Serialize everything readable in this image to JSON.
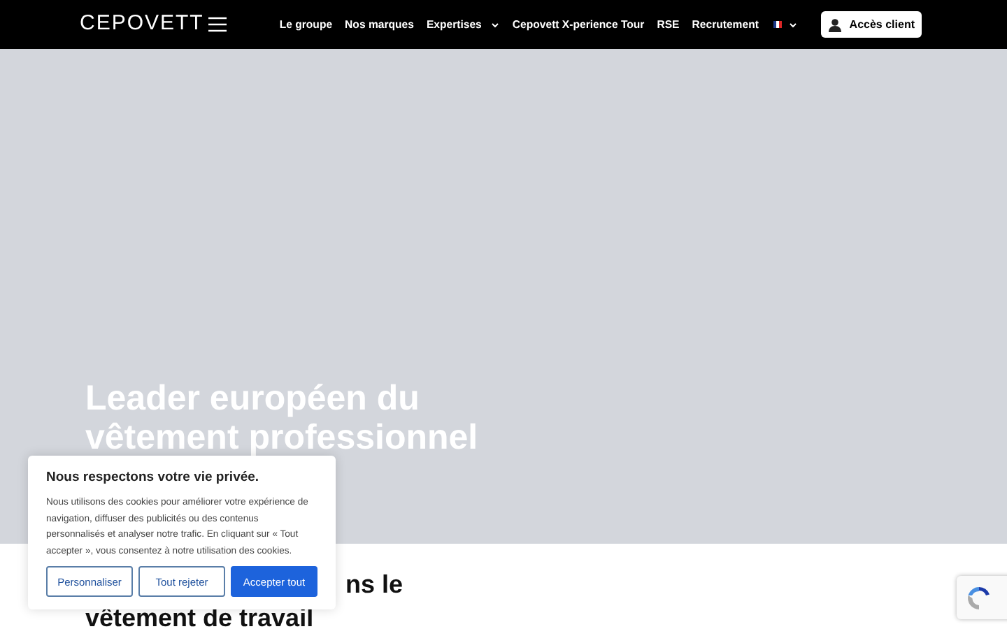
{
  "header": {
    "logo": "CEPOVETT",
    "nav": [
      {
        "label": "Le groupe",
        "dropdown": false
      },
      {
        "label": "Nos marques",
        "dropdown": false
      },
      {
        "label": "Expertises",
        "dropdown": true
      },
      {
        "label": "Cepovett X-perience Tour",
        "dropdown": false
      },
      {
        "label": "RSE",
        "dropdown": false
      },
      {
        "label": "Recrutement",
        "dropdown": false
      }
    ],
    "client_button": "Accès client"
  },
  "hero": {
    "title": "Leader européen du vêtement professionnel"
  },
  "section": {
    "title_line_1": "ns le",
    "title_line_2": "vêtement de travail"
  },
  "cookie_dialog": {
    "title": "Nous respectons votre vie privée.",
    "text": "Nous utilisons des cookies pour améliorer votre expérience de navigation, diffuser des publicités ou des contenus personnalisés et analyser notre trafic. En cliquant sur « Tout accepter », vous consentez à notre utilisation des cookies.",
    "buttons": [
      {
        "label": "Personnaliser",
        "kind": "outline"
      },
      {
        "label": "Tout rejeter",
        "kind": "outline"
      },
      {
        "label": "Accepter tout",
        "kind": "primary"
      }
    ]
  }
}
